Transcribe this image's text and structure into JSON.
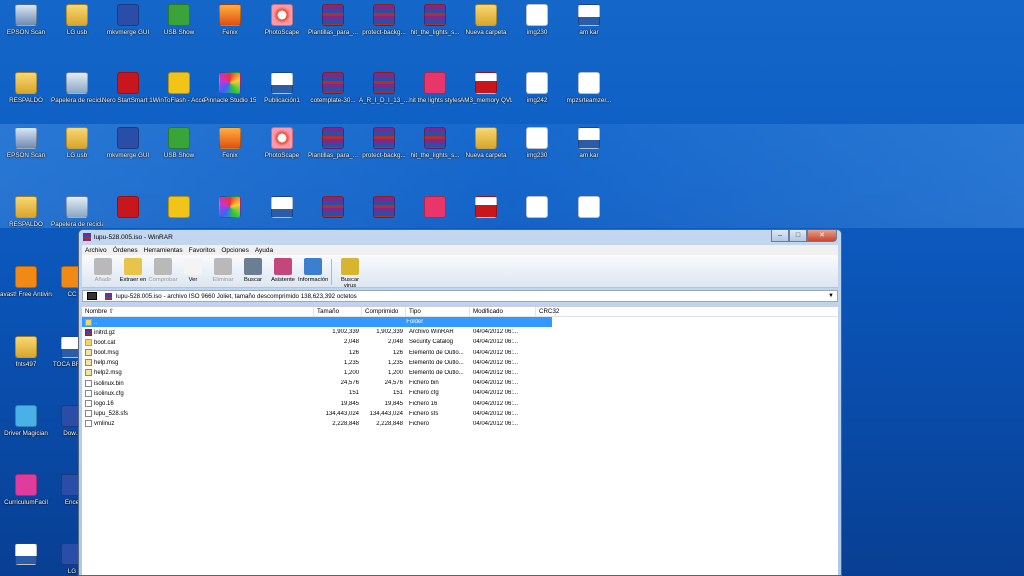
{
  "desktop_rows": [
    [
      {
        "label": "EPSON Scan",
        "icon": "scanner-icon",
        "cls": "scan"
      },
      {
        "label": "LG usb",
        "icon": "folder-icon",
        "cls": "folder"
      },
      {
        "label": "mkvmerge GUI",
        "icon": "mkvmerge-icon",
        "cls": "media"
      },
      {
        "label": "USB Show",
        "icon": "usb-show-icon",
        "cls": "green"
      },
      {
        "label": "Fenix",
        "icon": "fenix-icon",
        "cls": "fenix"
      },
      {
        "label": "PhotoScape",
        "icon": "photoscape-icon",
        "cls": "photo"
      },
      {
        "label": "Plantillas_para_...",
        "icon": "winrar-archive-icon",
        "cls": "rar"
      },
      {
        "label": "protect-backg...",
        "icon": "winrar-archive-icon",
        "cls": "rar"
      },
      {
        "label": "hit_the_lights_s...",
        "icon": "winrar-archive-icon",
        "cls": "rar"
      },
      {
        "label": "Nueva carpeta",
        "icon": "folder-icon",
        "cls": "folder"
      },
      {
        "label": "img230",
        "icon": "document-icon",
        "cls": "doc"
      },
      {
        "label": "am kar",
        "icon": "word-document-icon",
        "cls": "word"
      }
    ],
    [
      {
        "label": "RESPALDO",
        "icon": "folder-icon",
        "cls": "folder"
      },
      {
        "label": "Papelera de reciclaje",
        "icon": "recycle-bin-icon",
        "cls": "bin"
      },
      {
        "label": "Nero StartSmart 10",
        "icon": "nero-icon",
        "cls": "red"
      },
      {
        "label": "WinToFlash - Acceso directo",
        "icon": "wand-icon",
        "cls": "wand"
      },
      {
        "label": "Pinnacle Studio 15",
        "icon": "pinnacle-icon",
        "cls": "star"
      },
      {
        "label": "Publicación1",
        "icon": "publisher-icon",
        "cls": "word"
      },
      {
        "label": "cotemplate-30...",
        "icon": "winrar-archive-icon",
        "cls": "rar"
      },
      {
        "label": "A_R_I_D_I_13_...",
        "icon": "winrar-archive-icon",
        "cls": "rar"
      },
      {
        "label": "hit the lights styles",
        "icon": "pink-folder-icon",
        "cls": "pink"
      },
      {
        "label": "AM3_memory QVL",
        "icon": "pdf-icon",
        "cls": "pdf"
      },
      {
        "label": "img242",
        "icon": "document-icon",
        "cls": "doc"
      },
      {
        "label": "mpzsrteamzer...",
        "icon": "document-icon",
        "cls": "doc"
      }
    ],
    [
      {
        "label": "EPSON Scan",
        "icon": "scanner-icon",
        "cls": "scan"
      },
      {
        "label": "LG usb",
        "icon": "folder-icon",
        "cls": "folder"
      },
      {
        "label": "mkvmerge GUI",
        "icon": "mkvmerge-icon",
        "cls": "media"
      },
      {
        "label": "USB Show",
        "icon": "usb-show-icon",
        "cls": "green"
      },
      {
        "label": "Fenix",
        "icon": "fenix-icon",
        "cls": "fenix"
      },
      {
        "label": "PhotoScape",
        "icon": "photoscape-icon",
        "cls": "photo"
      },
      {
        "label": "Plantillas_para_...",
        "icon": "winrar-archive-icon",
        "cls": "rar"
      },
      {
        "label": "protect-backg...",
        "icon": "winrar-archive-icon",
        "cls": "rar"
      },
      {
        "label": "hit_the_lights_s...",
        "icon": "winrar-archive-icon",
        "cls": "rar"
      },
      {
        "label": "Nueva carpeta",
        "icon": "folder-icon",
        "cls": "folder"
      },
      {
        "label": "img230",
        "icon": "document-icon",
        "cls": "doc"
      },
      {
        "label": "am kar",
        "icon": "word-document-icon",
        "cls": "word"
      }
    ],
    [
      {
        "label": "RESPALDO",
        "icon": "folder-icon",
        "cls": "folder"
      },
      {
        "label": "Papelera de reciclaje",
        "icon": "recycle-bin-icon",
        "cls": "bin"
      },
      {
        "label": "",
        "icon": "nero-icon",
        "cls": "red"
      },
      {
        "label": "",
        "icon": "wand-icon",
        "cls": "wand"
      },
      {
        "label": "",
        "icon": "pinnacle-icon",
        "cls": "star"
      },
      {
        "label": "",
        "icon": "publisher-icon",
        "cls": "word"
      },
      {
        "label": "",
        "icon": "winrar-archive-icon",
        "cls": "rar"
      },
      {
        "label": "",
        "icon": "winrar-archive-icon",
        "cls": "rar"
      },
      {
        "label": "",
        "icon": "pink-folder-icon",
        "cls": "pink"
      },
      {
        "label": "",
        "icon": "pdf-icon",
        "cls": "pdf"
      },
      {
        "label": "",
        "icon": "document-icon",
        "cls": "doc"
      },
      {
        "label": "",
        "icon": "document-icon",
        "cls": "doc"
      }
    ]
  ],
  "desktop_left": [
    {
      "label": "avast! Free Antivirus",
      "icon": "avast-icon",
      "cls": "orange"
    },
    {
      "label": "fnts497",
      "icon": "folder-icon",
      "cls": "folder"
    },
    {
      "label": "Driver Magician",
      "icon": "driver-magician-icon",
      "cls": "magic"
    },
    {
      "label": "CurriculumFacil",
      "icon": "curriculum-icon",
      "cls": "curr"
    },
    {
      "label": "",
      "icon": "word-document-icon",
      "cls": "word"
    }
  ],
  "desktop_second_col": [
    {
      "label": "CC",
      "icon": "app-icon",
      "cls": "orange"
    },
    {
      "label": "TOCA BRZI...",
      "icon": "word-document-icon",
      "cls": "word"
    },
    {
      "label": "Dow...",
      "icon": "app-icon",
      "cls": "media"
    },
    {
      "label": "Ence",
      "icon": "app-icon",
      "cls": "media"
    },
    {
      "label": "LG",
      "icon": "app-icon",
      "cls": "media"
    }
  ],
  "window": {
    "title": "lupu-528.005.iso - WinRAR",
    "menu": [
      "Archivo",
      "Órdenes",
      "Herramientas",
      "Favoritos",
      "Opciones",
      "Ayuda"
    ],
    "toolbar": [
      {
        "label": "Añadir",
        "disabled": true,
        "icon": "add-icon",
        "color": "#b9b9b9"
      },
      {
        "label": "Extraer en",
        "disabled": false,
        "icon": "extract-icon",
        "color": "#e8c54a"
      },
      {
        "label": "Comprobar",
        "disabled": true,
        "icon": "test-icon",
        "color": "#b9b9b9"
      },
      {
        "label": "Ver",
        "disabled": false,
        "icon": "view-icon",
        "color": "#f4f4f4"
      },
      {
        "label": "Eliminar",
        "disabled": true,
        "icon": "delete-icon",
        "color": "#b9b9b9"
      },
      {
        "label": "Buscar",
        "disabled": false,
        "icon": "find-icon",
        "color": "#6a7f94"
      },
      {
        "label": "Asistente",
        "disabled": false,
        "icon": "wizard-icon",
        "color": "#c4467c"
      },
      {
        "label": "Información",
        "disabled": false,
        "icon": "info-icon",
        "color": "#3d7fcf"
      },
      {
        "label": "Buscar virus",
        "disabled": false,
        "icon": "virus-scan-icon",
        "color": "#d8b530"
      }
    ],
    "address": "lupu-528.005.iso - archivo ISO 9660 Joliet, tamaño descomprimido 138,623,392 octetos",
    "columns": {
      "name": "Nombre",
      "size": "Tamaño",
      "packed": "Comprimido",
      "type": "Tipo",
      "modified": "Modificado",
      "crc": "CRC32"
    },
    "rows": [
      {
        "name": "..",
        "size": "",
        "packed": "",
        "type": "Folder",
        "modified": "",
        "crc": "",
        "ico": "fold",
        "selected": true
      },
      {
        "name": "initrd.gz",
        "size": "1,902,339",
        "packed": "1,902,339",
        "type": "Archivo WinRAR",
        "modified": "04/04/2012 06:...",
        "crc": "",
        "ico": "gz"
      },
      {
        "name": "boot.cat",
        "size": "2,048",
        "packed": "2,048",
        "type": "Security Catalog",
        "modified": "04/04/2012 06:...",
        "crc": "",
        "ico": "fold"
      },
      {
        "name": "boot.msg",
        "size": "126",
        "packed": "126",
        "type": "Elemento de Outlo...",
        "modified": "04/04/2012 06:...",
        "crc": "",
        "ico": "msg"
      },
      {
        "name": "help.msg",
        "size": "1,235",
        "packed": "1,235",
        "type": "Elemento de Outlo...",
        "modified": "04/04/2012 06:...",
        "crc": "",
        "ico": "msg"
      },
      {
        "name": "help2.msg",
        "size": "1,200",
        "packed": "1,200",
        "type": "Elemento de Outlo...",
        "modified": "04/04/2012 06:...",
        "crc": "",
        "ico": "msg"
      },
      {
        "name": "isolinux.bin",
        "size": "24,576",
        "packed": "24,576",
        "type": "Fichero bin",
        "modified": "04/04/2012 06:...",
        "crc": "",
        "ico": "file"
      },
      {
        "name": "isolinux.cfg",
        "size": "151",
        "packed": "151",
        "type": "Fichero cfg",
        "modified": "04/04/2012 06:...",
        "crc": "",
        "ico": "file"
      },
      {
        "name": "logo.16",
        "size": "19,845",
        "packed": "19,845",
        "type": "Fichero 16",
        "modified": "04/04/2012 06:...",
        "crc": "",
        "ico": "file"
      },
      {
        "name": "lupu_528.sfs",
        "size": "134,443,024",
        "packed": "134,443,024",
        "type": "Fichero sfs",
        "modified": "04/04/2012 06:...",
        "crc": "",
        "ico": "file"
      },
      {
        "name": "vmlinuz",
        "size": "2,228,848",
        "packed": "2,228,848",
        "type": "Fichero",
        "modified": "04/04/2012 06:...",
        "crc": "",
        "ico": "file"
      }
    ]
  }
}
